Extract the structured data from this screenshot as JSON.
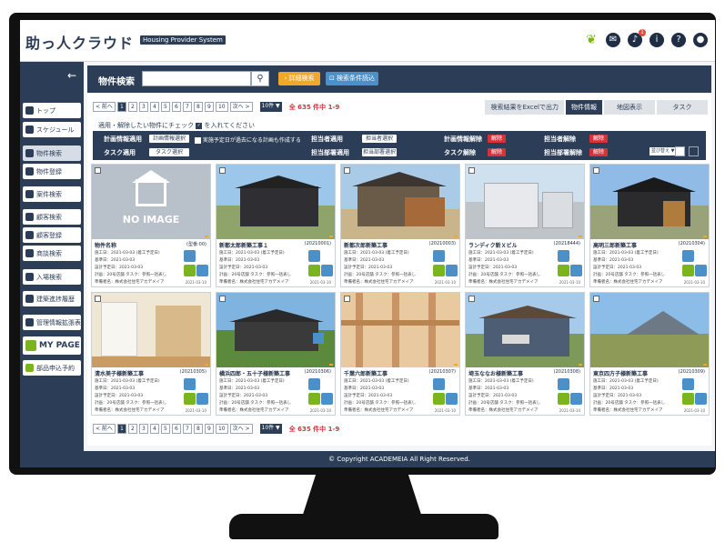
{
  "header": {
    "logo": "助っ人クラウド",
    "tag": "Housing Provider System",
    "notification_count": "1"
  },
  "sidebar": {
    "items": [
      "トップ",
      "スケジュール",
      "物件検索",
      "物件登録",
      "案件検索",
      "顧客検索",
      "顧客登録",
      "商談検索",
      "入場検索",
      "建築進捗履歴",
      "管理情報拡張表"
    ],
    "mypage": "MY PAGE",
    "order": "部品申込予約"
  },
  "search": {
    "title": "物件検索",
    "adv_label": "詳細検索",
    "load_label": "検索条件読込"
  },
  "pager": {
    "prev": "< 前へ",
    "next": "次へ >",
    "pages": [
      "1",
      "2",
      "3",
      "4",
      "5",
      "6",
      "7",
      "8",
      "9",
      "10"
    ],
    "per_page": "10件 ▼",
    "hits": "全 635 件中 1-9"
  },
  "tabs": [
    "検索結果をExcelで出力",
    "物件情報",
    "地図表示",
    "タスク"
  ],
  "hint": "適用・解除したい物件にチェック",
  "hint2": "を入れてください",
  "filter": {
    "plan_apply": "計画情報適用",
    "plan_select": "計画情報選択",
    "plan_note": "実施予定日が過去になる計画も作成する",
    "staff_apply": "担当者適用",
    "staff_select": "担当者選択",
    "plan_release": "計画情報解除",
    "staff_release": "担当者解除",
    "task_apply": "タスク適用",
    "task_select": "タスク選択",
    "dept_apply": "担当部署適用",
    "dept_select": "担当部署選択",
    "task_release": "タスク解除",
    "dept_release": "担当部署解除",
    "release": "解除",
    "sort": "並び替え"
  },
  "cards": [
    {
      "title": "物件名称",
      "no": "(型番:00)",
      "placeholder": "NO IMAGE",
      "photo": "none"
    },
    {
      "title": "新都太郎新築工事１",
      "no": "(20210001)",
      "photo": "house-dark"
    },
    {
      "title": "新都次郎新築工事",
      "no": "(20210003)",
      "photo": "house-brown"
    },
    {
      "title": "ランディク新Ｘビル",
      "no": "(20218444)",
      "photo": "building"
    },
    {
      "title": "高明三郎新築工事",
      "no": "(20210304)",
      "photo": "house-black"
    },
    {
      "title": "清水美子様新築工事",
      "no": "(20210305)",
      "photo": "interior"
    },
    {
      "title": "横浜四郎・五十子様新築工事",
      "no": "(20210306)",
      "photo": "house-green"
    },
    {
      "title": "千葉六郎新築工事",
      "no": "(20210307)",
      "photo": "frame"
    },
    {
      "title": "埼玉ななお様新築工事",
      "no": "(20210308)",
      "photo": "house-blue"
    },
    {
      "title": "東京四方子様新築工事",
      "no": "(20210309)",
      "photo": "field"
    }
  ],
  "card_lines": [
    "施工日：",
    "基準日：",
    "設計予定日：",
    "計画：",
    "準備者名："
  ],
  "card_line_values": [
    "2021-03-03 (着工予定日)",
    "2021-03-03",
    "2021-03-03",
    "20号店舗  タスク：参照一括表し",
    "株式会社住宅アカデメイア"
  ],
  "card_date": "2021-03-10",
  "footer": "© Copyright ACADEMEIA All Right Reserved."
}
